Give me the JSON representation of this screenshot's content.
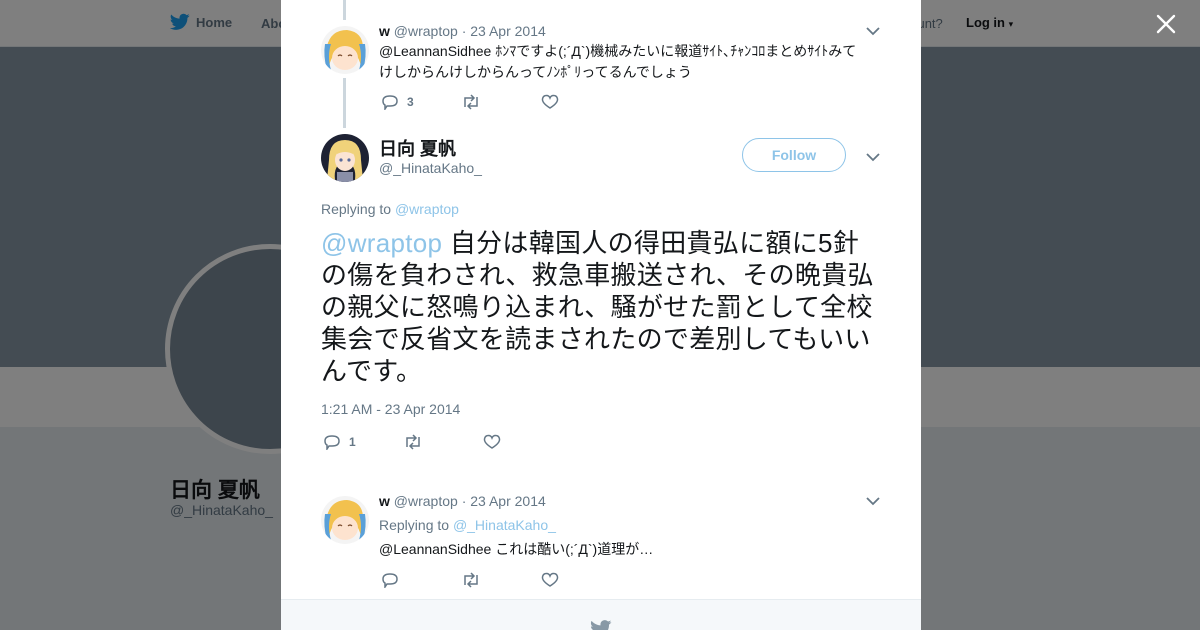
{
  "nav": {
    "home": "Home",
    "about": "Abo",
    "account_q": "account?",
    "login": "Log in"
  },
  "profile": {
    "name": "日向 夏帆",
    "handle": "@_HinataKaho_"
  },
  "modal": {
    "tweet1": {
      "name": "w",
      "handle": "@wraptop",
      "date": "· 23 Apr 2014",
      "text_line1": "@LeannanSidhee ﾎﾝﾏですよ(;´Д`)機械みたいに報道ｻｲﾄ､ﾁｬﾝｺﾛまとめｻｲﾄみて",
      "text_line2": "けしからんけしからんってﾉﾝﾎﾟﾘってるんでしょう",
      "reply_count": "3"
    },
    "main_tweet": {
      "name": "日向 夏帆",
      "handle": "@_HinataKaho_",
      "follow_label": "Follow",
      "replying_label": "Replying to",
      "replying_handle": "@wraptop",
      "mention": "@wraptop",
      "text": " 自分は韓国人の得田貴弘に額に5針の傷を負わされ、救急車搬送され、その晩貴弘の親父に怒鳴り込まれ、騒がせた罰として全校集会で反省文を読まされたので差別してもいいんです。",
      "timestamp": "1:21 AM - 23 Apr 2014",
      "reply_count": "1"
    },
    "tweet3": {
      "name": "w",
      "handle": "@wraptop",
      "date": "· 23 Apr 2014",
      "replying_label": "Replying to",
      "replying_handle": "@_HinataKaho_",
      "text": "@LeannanSidhee これは酷い(;´Д`)道理が…"
    }
  },
  "colors": {
    "accent": "#1da1f2",
    "link_light": "#8ec4e8",
    "muted": "#657786",
    "overlay": "rgba(0,0,0,0.5)"
  },
  "icons": [
    "twitter-bird-icon",
    "close-icon",
    "reply-icon",
    "retweet-icon",
    "like-icon",
    "chevron-down-icon"
  ]
}
